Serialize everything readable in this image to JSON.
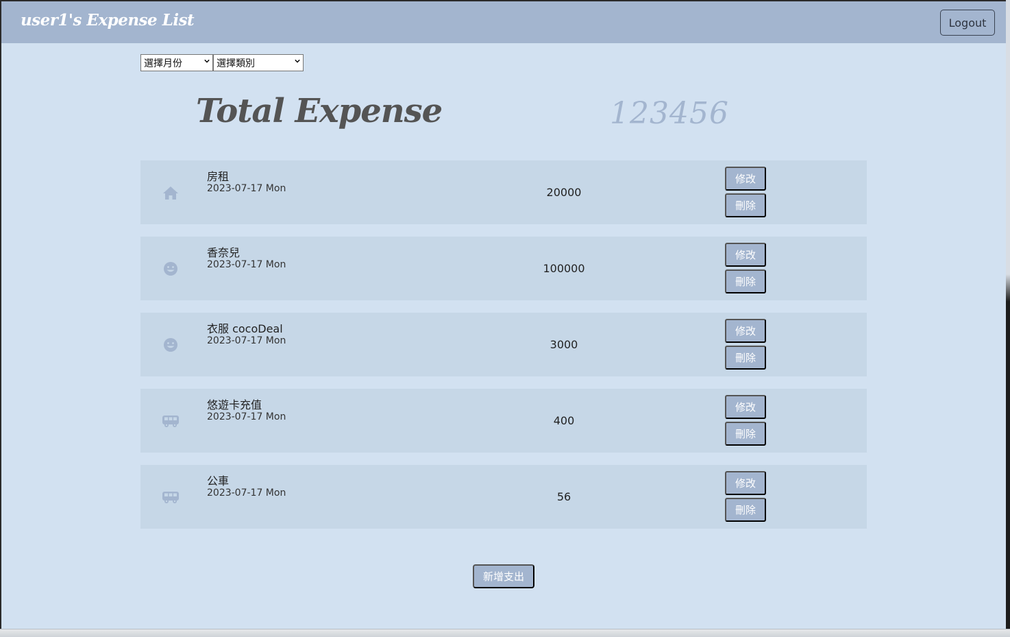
{
  "navbar": {
    "brand": "user1's Expense List",
    "logout_label": "Logout"
  },
  "filters": {
    "month_selected": "選擇月份",
    "category_selected": "選擇類別"
  },
  "summary": {
    "label": "Total Expense",
    "value": "123456"
  },
  "expenses": [
    {
      "icon": "house-icon",
      "name": "房租",
      "date": "2023-07-17 Mon",
      "amount": "20000",
      "edit_label": "修改",
      "delete_label": "刪除"
    },
    {
      "icon": "smiley-icon",
      "name": "香奈兒",
      "date": "2023-07-17 Mon",
      "amount": "100000",
      "edit_label": "修改",
      "delete_label": "刪除"
    },
    {
      "icon": "smiley-icon",
      "name": "衣服 cocoDeal",
      "date": "2023-07-17 Mon",
      "amount": "3000",
      "edit_label": "修改",
      "delete_label": "刪除"
    },
    {
      "icon": "van-icon",
      "name": "悠遊卡充值",
      "date": "2023-07-17 Mon",
      "amount": "400",
      "edit_label": "修改",
      "delete_label": "刪除"
    },
    {
      "icon": "van-icon",
      "name": "公車",
      "date": "2023-07-17 Mon",
      "amount": "56",
      "edit_label": "修改",
      "delete_label": "刪除"
    }
  ],
  "add_button_label": "新增支出",
  "colors": {
    "background": "#d2e1f1",
    "navbar": "#a3b5cf",
    "row": "#c6d7e7",
    "button": "#a3b5cf",
    "title_text": "#545454"
  }
}
